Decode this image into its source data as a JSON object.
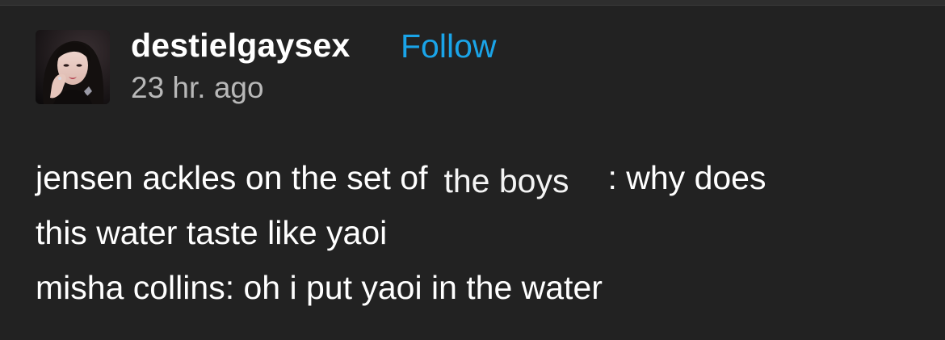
{
  "post": {
    "username": "destielgaysex",
    "follow_label": "Follow",
    "timestamp": "23 hr. ago",
    "avatar_icon": "user-avatar-photo",
    "line1_before": "jensen ackles on the set of",
    "line1_overlay": "the boys",
    "line1_after": ": why does",
    "line2": "this water taste like yaoi",
    "line3": "misha collins: oh i put yaoi in the water"
  },
  "colors": {
    "background": "#222222",
    "username": "#ffffff",
    "follow": "#1aa4e8",
    "timestamp": "#b8b8b8",
    "body_text": "#ffffff"
  }
}
